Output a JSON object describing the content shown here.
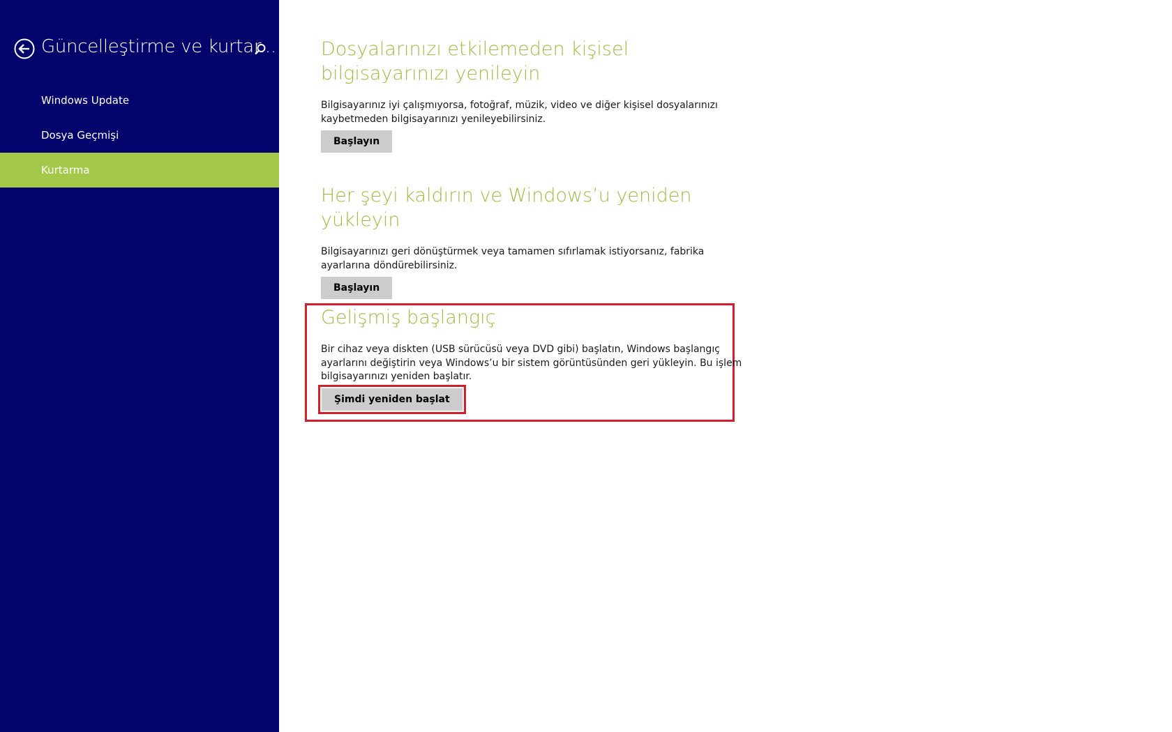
{
  "sidebar": {
    "title": "Güncelleştirme ve kurtar...",
    "back_icon": "back-arrow-circle-icon",
    "search_icon": "search-icon",
    "items": [
      {
        "label": "Windows Update",
        "selected": false
      },
      {
        "label": "Dosya Geçmişi",
        "selected": false
      },
      {
        "label": "Kurtarma",
        "selected": true
      }
    ],
    "colors": {
      "background": "#03046b",
      "selected": "#a3c84a"
    }
  },
  "main": {
    "sections": [
      {
        "title": "Dosyalarınızı etkilemeden kişisel bilgisayarınızı yenileyin",
        "description": "Bilgisayarınız iyi çalışmıyorsa, fotoğraf, müzik, video ve diğer kişisel dosyalarınızı kaybetmeden bilgisayarınızı yenileyebilirsiniz.",
        "button": "Başlayın"
      },
      {
        "title": "Her şeyi kaldırın ve Windows’u yeniden yükleyin",
        "description": "Bilgisayarınızı geri dönüştürmek veya tamamen sıfırlamak istiyorsanız, fabrika ayarlarına döndürebilirsiniz.",
        "button": "Başlayın"
      },
      {
        "title": "Gelişmiş başlangıç",
        "description": "Bir cihaz veya diskten (USB sürücüsü veya DVD gibi) başlatın, Windows başlangıç ayarlarını değiştirin veya Windows’u bir sistem görüntüsünden geri yükleyin. Bu işlem bilgisayarınızı yeniden başlatır.",
        "button": "Şimdi yeniden başlat"
      }
    ],
    "colors": {
      "title": "#9ebd48",
      "highlight": "#d0202e"
    }
  }
}
